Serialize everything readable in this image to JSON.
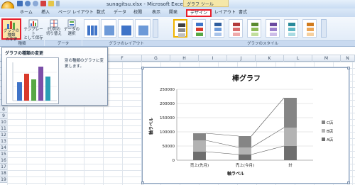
{
  "window": {
    "title": "sunagitsu.xlsx - Microsoft Excel",
    "context_tab": "グラフ ツール"
  },
  "tabs": [
    {
      "label": "ホーム",
      "active": false
    },
    {
      "label": "挿入",
      "active": false
    },
    {
      "label": "ページ レイアウト",
      "active": false
    },
    {
      "label": "数式",
      "active": false
    },
    {
      "label": "データ",
      "active": false
    },
    {
      "label": "校閲",
      "active": false
    },
    {
      "label": "表示",
      "active": false
    },
    {
      "label": "開発",
      "active": false
    },
    {
      "label": "デザイン",
      "active": true
    },
    {
      "label": "レイアウト",
      "active": false
    },
    {
      "label": "書式",
      "active": false
    }
  ],
  "ribbon": {
    "type_group_label": "種類",
    "data_group_label": "データ",
    "layout_group_label": "グラフのレイアウト",
    "styles_group_label": "グラフのスタイル",
    "change_type_label_1": "グラフの種類",
    "change_type_label_2": "の変更",
    "save_template_label_1": "テンプレート",
    "save_template_label_2": "として保存",
    "switch_row_col_label_1": "行/列の",
    "switch_row_col_label_2": "切り替え",
    "select_data_label_1": "データの",
    "select_data_label_2": "選択"
  },
  "columns": [
    "A",
    "B",
    "C",
    "D",
    "E",
    "F",
    "G",
    "H",
    "I",
    "J",
    "K",
    "L",
    "M",
    "N"
  ],
  "rows": [
    "1",
    "2",
    "3",
    "4",
    "5",
    "6",
    "7",
    "8",
    "9",
    "10",
    "11",
    "12",
    "13",
    "14",
    "15",
    "16",
    "17",
    "18",
    "19"
  ],
  "tooltip": {
    "title": "グラフの種類の変更",
    "description": "別の種類のグラフに変更します。"
  },
  "chart_data": {
    "type": "bar",
    "stacked": true,
    "title": "棒グラフ",
    "xlabel": "軸ラベル",
    "ylabel": "軸ラベル",
    "categories": [
      "売上(先月)",
      "売上(今月)",
      "計"
    ],
    "ylim": [
      0,
      250000
    ],
    "yticks": [
      0,
      50000,
      100000,
      150000,
      200000,
      250000
    ],
    "legend_position": "right",
    "series": [
      {
        "name": "A店",
        "values": [
          30000,
          20000,
          50000
        ],
        "color": "#6e6e6e"
      },
      {
        "name": "B店",
        "values": [
          40000,
          25000,
          65000
        ],
        "color": "#b3b3b3"
      },
      {
        "name": "C店",
        "values": [
          25000,
          40000,
          105000
        ],
        "color": "#858585"
      }
    ]
  },
  "colors": {
    "accent_red": "#e81e2a",
    "ribbon_blue": "#dde9f7"
  }
}
